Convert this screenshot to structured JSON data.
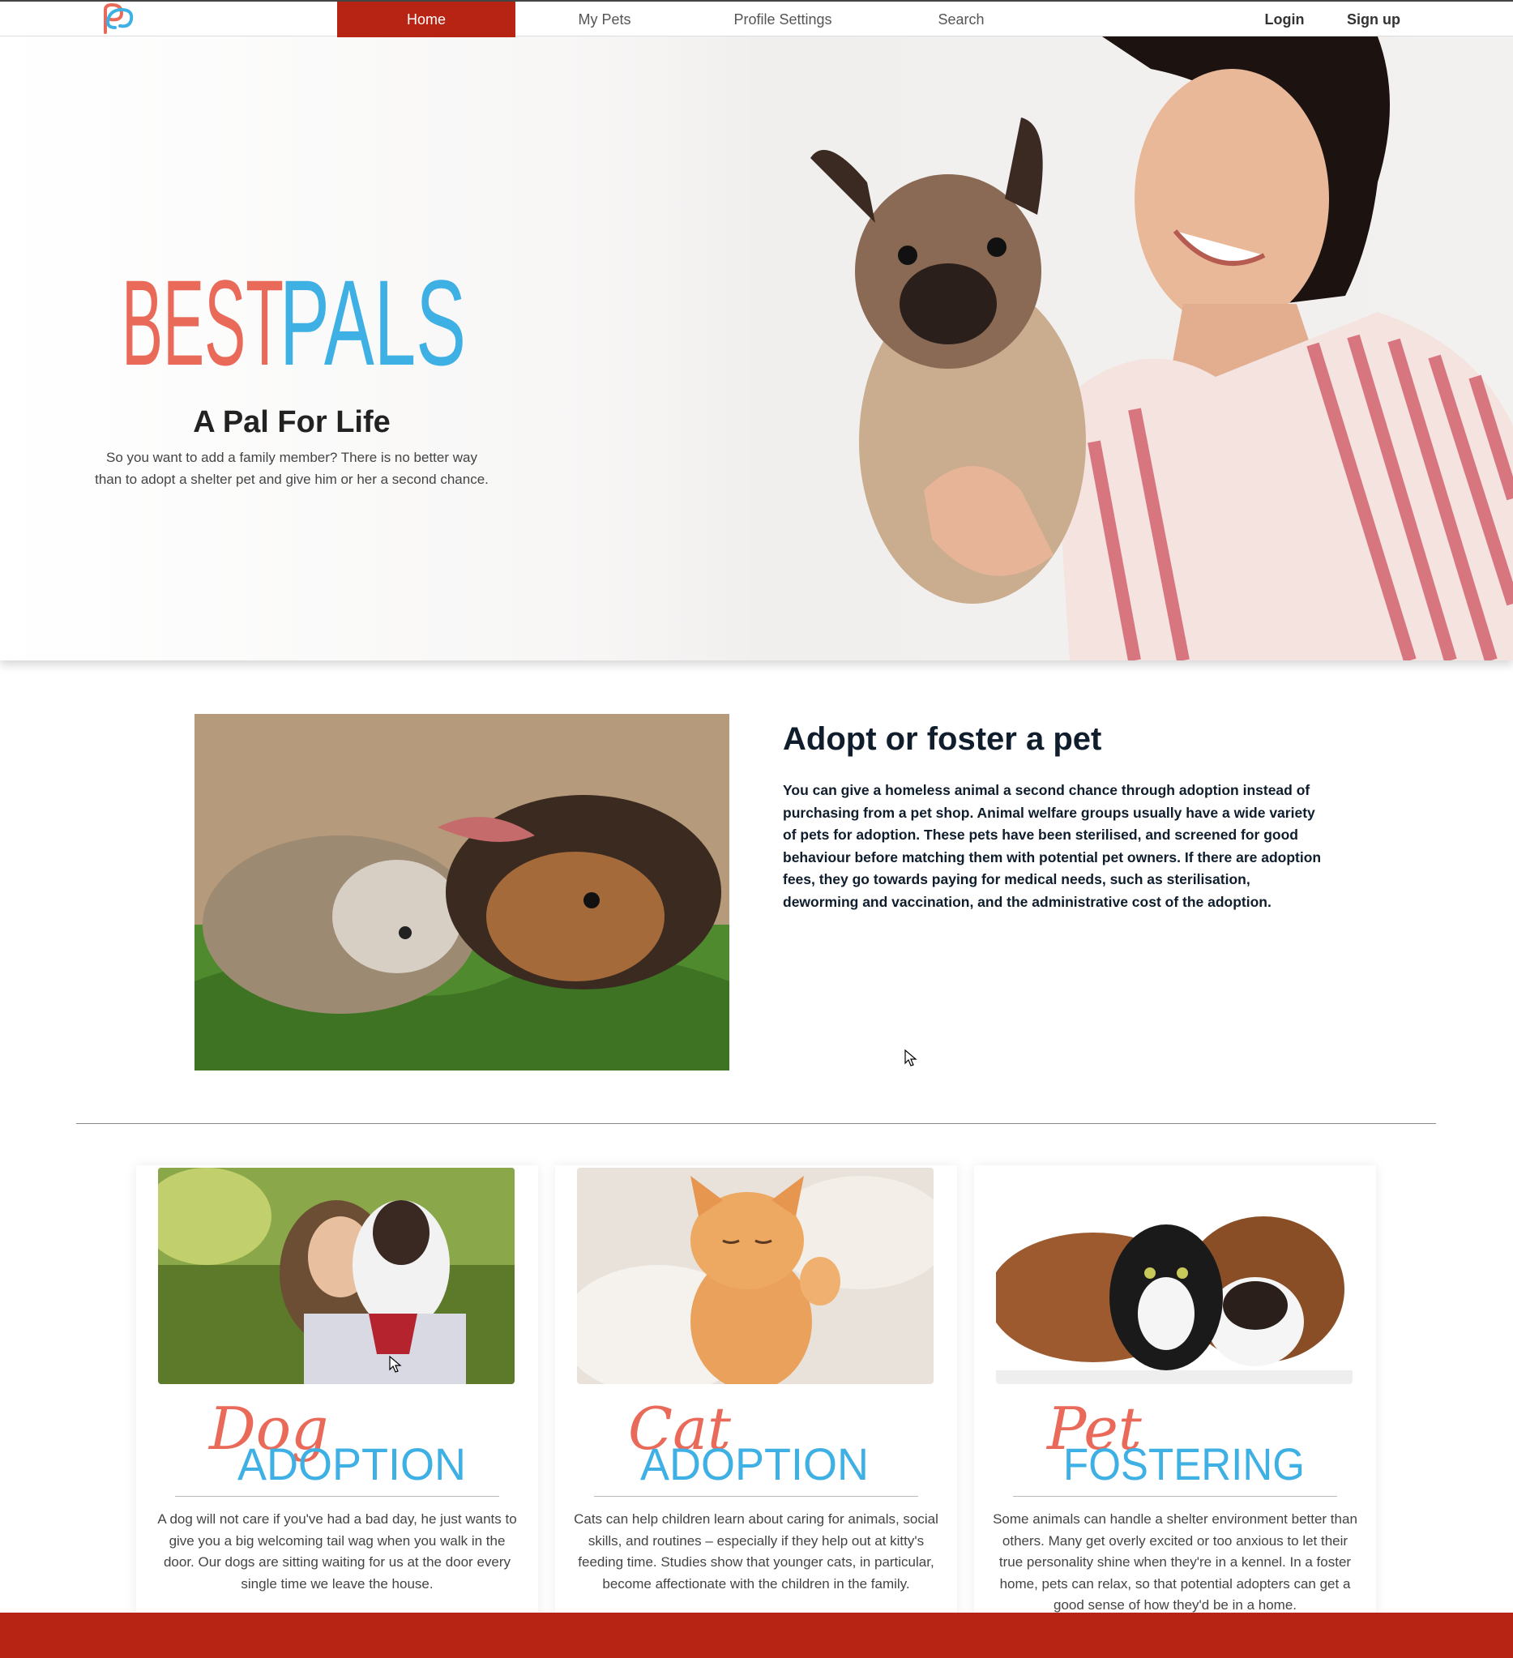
{
  "nav": {
    "items": [
      {
        "label": "Home",
        "active": true
      },
      {
        "label": "My Pets",
        "active": false
      },
      {
        "label": "Profile Settings",
        "active": false
      },
      {
        "label": "Search",
        "active": false
      }
    ],
    "login": "Login",
    "signup": "Sign up",
    "accent_color": "#b82413"
  },
  "hero": {
    "brand_part1": "BEST",
    "brand_part2": "PALS",
    "brand_color1": "#ea6a5a",
    "brand_color2": "#3eb0e4",
    "tagline": "A Pal For Life",
    "text": "So you want to add a family member? There is no better way than to adopt a shelter pet and give him or her a second chance."
  },
  "about": {
    "title": "Adopt or foster a pet",
    "text": "You can give a homeless animal a second chance through adoption instead of purchasing from a pet shop. Animal welfare groups usually have a wide variety of pets for adoption. These pets have been sterilised, and screened for good behaviour before matching them with potential pet owners. If there are adoption fees, they go towards paying for medical needs, such as sterilisation, deworming and vaccination, and the administrative cost of the adoption."
  },
  "cards": [
    {
      "script_word": "Dog",
      "caps_word": "ADOPTION",
      "text": "A dog will not care if you've had a bad day, he just wants to give you a big welcoming tail wag when you walk in the door. Our dogs are sitting waiting for us at the door every single time we leave the house."
    },
    {
      "script_word": "Cat",
      "caps_word": "ADOPTION",
      "text": "Cats can help children learn about caring for animals, social skills, and routines – especially if they help out at kitty's feeding time. Studies show that younger cats, in particular, become affectionate with the children in the family."
    },
    {
      "script_word": "Pet",
      "caps_word": "FOSTERING",
      "text": "Some animals can handle a shelter environment better than others. Many get overly excited or too anxious to let their true personality shine when they're in a kennel. In a foster home, pets can relax, so that potential adopters can get a good sense of how they'd be in a home."
    }
  ]
}
